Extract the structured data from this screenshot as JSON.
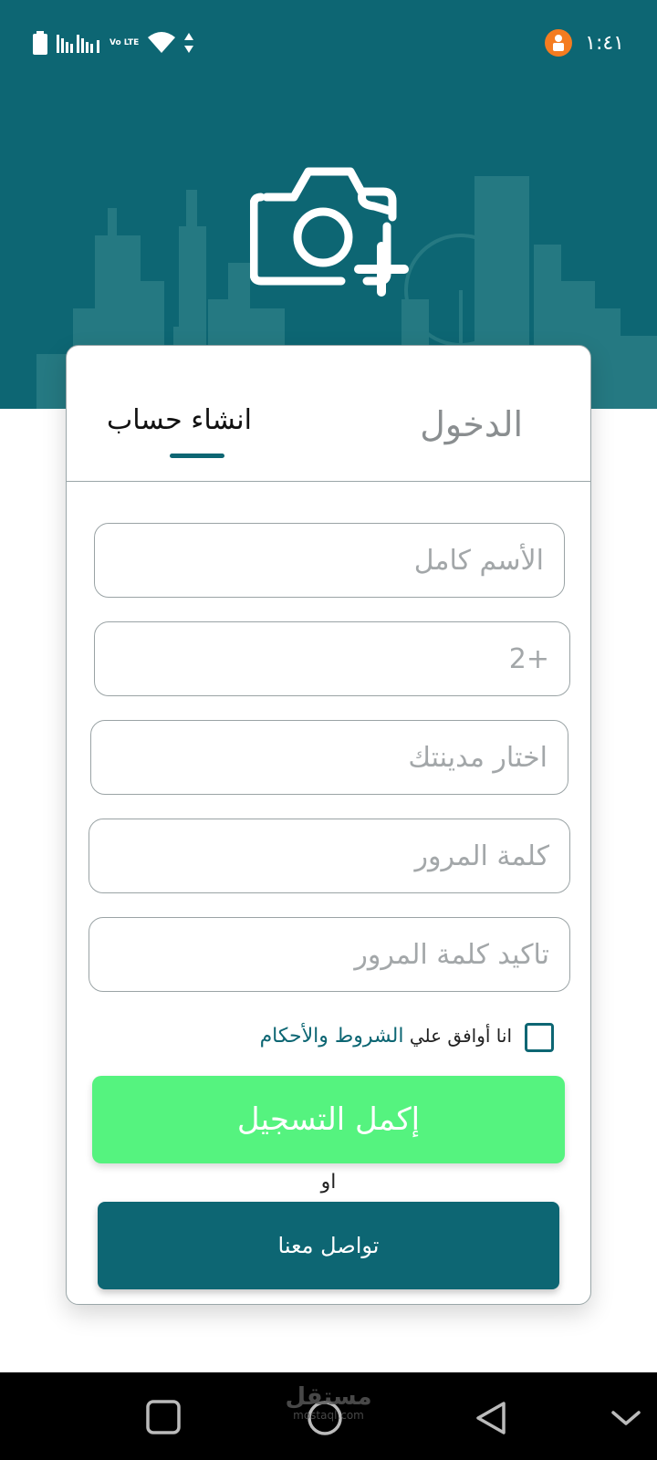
{
  "status_bar": {
    "time": "١:٤١",
    "network": "Vo LTE"
  },
  "tabs": {
    "login": "الدخول",
    "register": "انشاء حساب"
  },
  "form": {
    "full_name_placeholder": "الأسم كامل",
    "phone_prefix": "+2",
    "city_placeholder": "اختار مدينتك",
    "password_placeholder": "كلمة المرور",
    "confirm_password_placeholder": "تاكيد كلمة المرور"
  },
  "terms": {
    "prefix": "انا أوافق علي",
    "link": "الشروط والأحكام",
    "checked": false
  },
  "buttons": {
    "register": "إكمل التسجيل",
    "or": "او",
    "contact": "تواصل معنا"
  },
  "watermark": {
    "arabic": "مستقل",
    "latin": "mostaql.com"
  },
  "colors": {
    "primary": "#0d6673",
    "accent_green": "#55f37f",
    "placeholder": "#a3a7a9"
  },
  "icons": [
    "battery-icon",
    "signal-icon",
    "wifi-icon",
    "data-arrows-icon",
    "notification-badge-icon",
    "camera-add-icon",
    "recent-apps-icon",
    "home-icon",
    "back-icon",
    "nav-collapse-icon"
  ]
}
